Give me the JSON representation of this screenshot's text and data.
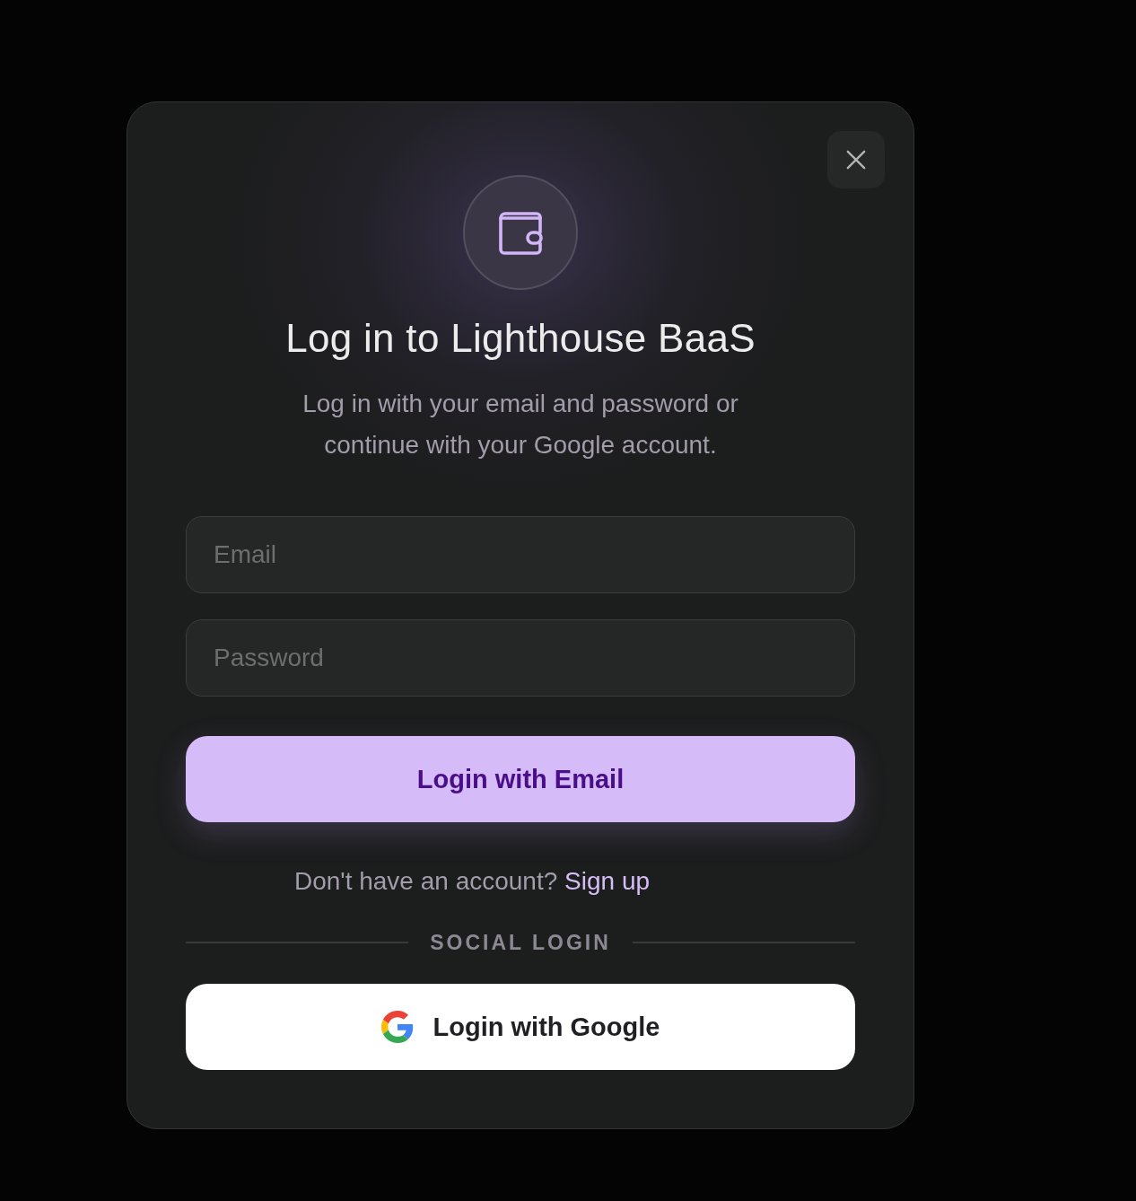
{
  "dialog": {
    "title": "Log in to Lighthouse BaaS",
    "subtitle": "Log in with your email and password or continue with your Google account.",
    "fields": [
      {
        "placeholder": "Email"
      },
      {
        "placeholder": "Password"
      }
    ],
    "primary_button": "Login with Email",
    "signup": {
      "prompt": "Don't have an account?",
      "link": "Sign up"
    },
    "divider": "SOCIAL LOGIN",
    "social_buttons": [
      {
        "label": "Login with Google"
      }
    ]
  }
}
